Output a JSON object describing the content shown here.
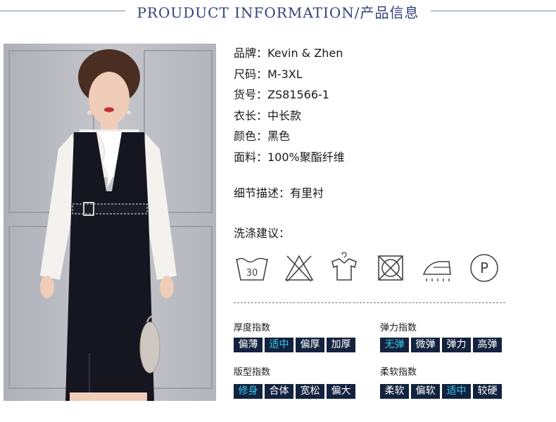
{
  "header": {
    "title": "PROUDUCT INFORMATION/产品信息"
  },
  "info": [
    "品牌：Kevin & Zhen",
    "尺码：M-3XL",
    "货号：ZS81566-1",
    "衣长：中长款",
    "颜色：黑色",
    "面料：100%聚酯纤维"
  ],
  "detail": "细节描述：有里衬",
  "wash": {
    "title": "洗涤建议：",
    "icons": [
      "wash-30-icon",
      "no-bleach-icon",
      "hang-dry-icon",
      "no-tumble-dry-icon",
      "iron-icon",
      "dry-clean-p-icon"
    ],
    "wash_temp": "30",
    "dry_clean_letter": "P"
  },
  "indices": {
    "thickness": {
      "label": "厚度指数",
      "options": [
        "偏薄",
        "适中",
        "偏厚",
        "加厚"
      ],
      "selected": "适中"
    },
    "elasticity": {
      "label": "弹力指数",
      "options": [
        "无弹",
        "微弹",
        "弹力",
        "高弹"
      ],
      "selected": "无弹"
    },
    "fit": {
      "label": "版型指数",
      "options": [
        "修身",
        "合体",
        "宽松",
        "偏大"
      ],
      "selected": "修身"
    },
    "softness": {
      "label": "柔软指数",
      "options": [
        "柔软",
        "偏软",
        "适中",
        "较硬"
      ],
      "selected": "适中"
    }
  },
  "colors": {
    "tag_bg": "#12223f",
    "tag_text": "#ffffff",
    "tag_selected_text": "#38c8e6",
    "title_color": "#33437a"
  }
}
